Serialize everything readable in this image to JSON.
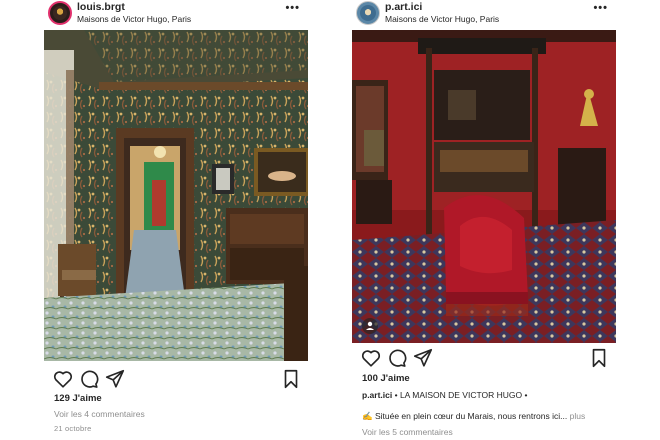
{
  "posts": [
    {
      "username": "louis.brgt",
      "location": "Maisons de Victor Hugo, Paris",
      "more_label": "•••",
      "likes": "129 J'aime",
      "comments_link": "Voir les 4 commentaires",
      "date": "21 octobre",
      "icons": [
        "heart-icon",
        "comment-icon",
        "share-icon",
        "bookmark-icon"
      ]
    },
    {
      "username": "p.art.ici",
      "location": "Maisons de Victor Hugo, Paris",
      "more_label": "•••",
      "likes": "100 J'aime",
      "caption_user": "p.art.ici",
      "caption_title": "• LA MAISON DE VICTOR HUGO •",
      "caption_text": "✍️ Située en plein cœur du Marais, nous rentrons ici...",
      "caption_more": "plus",
      "comments_link": "Voir les 5 commentaires",
      "icons": [
        "heart-icon",
        "comment-icon",
        "share-icon",
        "bookmark-icon"
      ]
    }
  ]
}
